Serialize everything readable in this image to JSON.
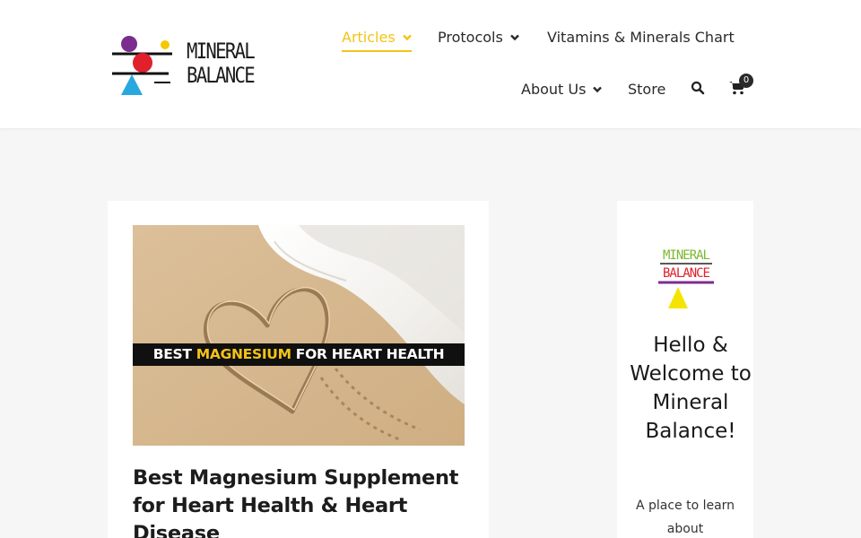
{
  "brand": {
    "logo_lines": [
      "MINERAL",
      "BALANCE"
    ],
    "colors": {
      "accent": "#f3c318",
      "purple": "#7b2d8e",
      "red": "#e0202a",
      "yellow": "#f5c800",
      "blue": "#29a8e0"
    }
  },
  "nav": {
    "articles": "Articles",
    "protocols": "Protocols",
    "vitamins_chart": "Vitamins & Minerals Chart",
    "about": "About Us",
    "store": "Store",
    "search_icon": "search-icon",
    "cart_icon": "cart-icon",
    "cart_count": "0"
  },
  "post": {
    "image_banner_pre": "BEST ",
    "image_banner_highlight": "MAGNESIUM",
    "image_banner_post": " FOR HEART HEALTH",
    "title": "Best Magnesium Supplement for Heart Health & Heart Disease"
  },
  "sidebar": {
    "logo_lines": [
      "MINERAL",
      "BALANCE"
    ],
    "heading": "Hello & Welcome to Mineral Balance!",
    "text": "A place to learn about"
  }
}
